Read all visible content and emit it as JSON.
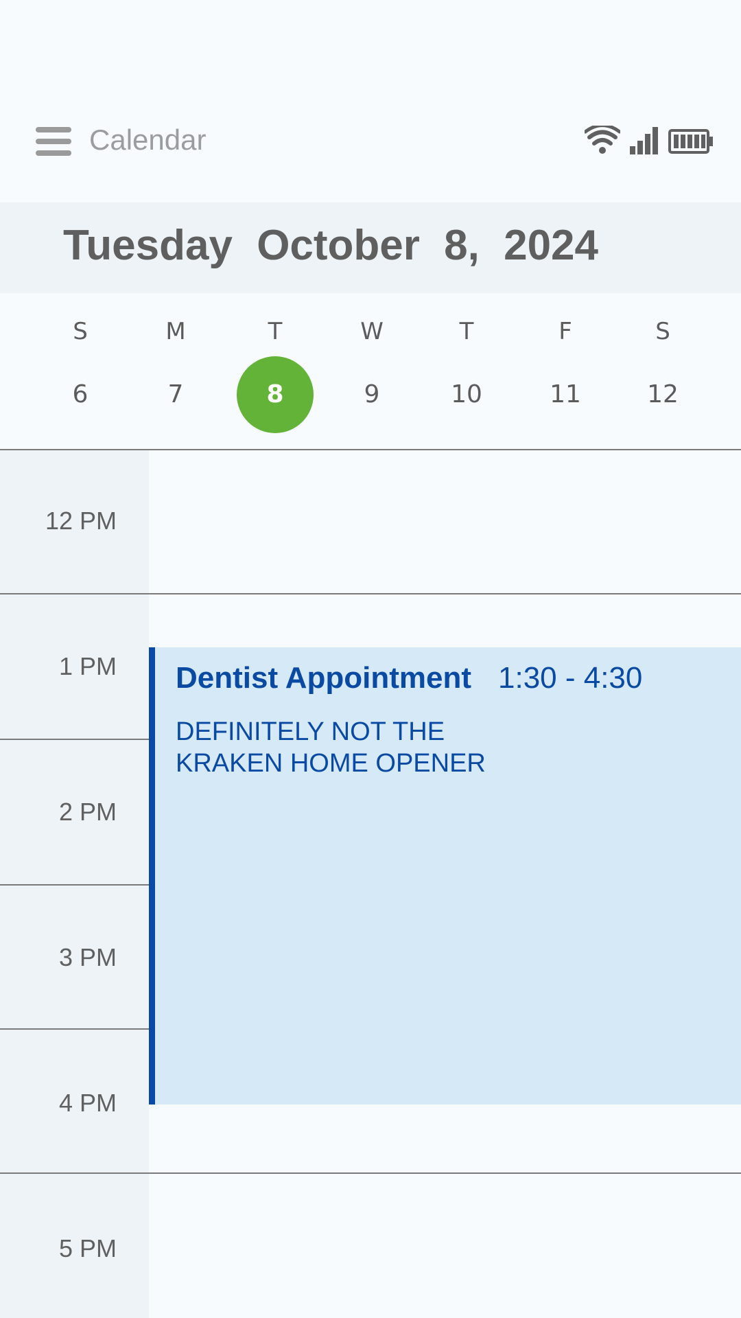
{
  "header": {
    "title": "Calendar",
    "icons": [
      "menu-icon",
      "wifi-icon",
      "cellular-signal-icon",
      "battery-icon"
    ]
  },
  "date_banner": {
    "weekday": "Tuesday",
    "month": "October",
    "day": "8,",
    "year": "2024"
  },
  "week": {
    "days": [
      {
        "dow": "S",
        "date": "6"
      },
      {
        "dow": "M",
        "date": "7"
      },
      {
        "dow": "T",
        "date": "8"
      },
      {
        "dow": "W",
        "date": "9"
      },
      {
        "dow": "T",
        "date": "10"
      },
      {
        "dow": "F",
        "date": "11"
      },
      {
        "dow": "S",
        "date": "12"
      }
    ],
    "selected_date": "8"
  },
  "timeline": {
    "hours": [
      "12 PM",
      "1 PM",
      "2 PM",
      "3 PM",
      "4 PM",
      "5 PM"
    ]
  },
  "event": {
    "title": "Dentist Appointment",
    "time": "1:30 - 4:30",
    "description_line1": "DEFINITELY NOT THE",
    "description_line2": "KRAKEN HOME OPENER"
  },
  "colors": {
    "background": "#f7fbfd",
    "panel": "#edf3f6",
    "selected_day": "#62b337",
    "event_fill": "#d5e9f7",
    "event_accent": "#0a4aa3",
    "text_gray": "#5f5f5f"
  }
}
